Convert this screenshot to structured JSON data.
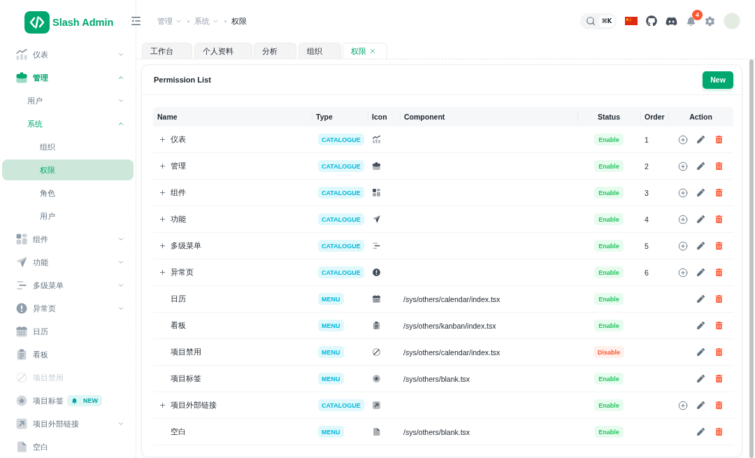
{
  "sidebar": {
    "title": "Slash Admin",
    "items": [
      {
        "label": "仪表",
        "expanded": false,
        "selected": false,
        "disabled": false
      },
      {
        "label": "管理",
        "expanded": true,
        "selected": false,
        "disabled": false,
        "children": [
          {
            "label": "用户",
            "expanded": false,
            "selected": false
          },
          {
            "label": "系统",
            "expanded": true,
            "selected": false,
            "children": [
              {
                "label": "组织",
                "selected": false
              },
              {
                "label": "权限",
                "selected": true
              },
              {
                "label": "角色",
                "selected": false
              },
              {
                "label": "用户",
                "selected": false
              }
            ]
          }
        ]
      },
      {
        "label": "组件",
        "expanded": false,
        "selected": false,
        "disabled": false
      },
      {
        "label": "功能",
        "expanded": false,
        "selected": false,
        "disabled": false
      },
      {
        "label": "多级菜单",
        "expanded": false,
        "selected": false,
        "disabled": false
      },
      {
        "label": "异常页",
        "expanded": false,
        "selected": false,
        "disabled": false
      },
      {
        "label": "日历",
        "selected": false,
        "disabled": false
      },
      {
        "label": "看板",
        "selected": false,
        "disabled": false
      },
      {
        "label": "项目禁用",
        "selected": false,
        "disabled": true
      },
      {
        "label": "项目标签",
        "selected": false,
        "disabled": false,
        "badge": "NEW"
      },
      {
        "label": "项目外部链接",
        "expanded": false,
        "selected": false,
        "disabled": false
      },
      {
        "label": "空白",
        "selected": false,
        "disabled": false
      }
    ]
  },
  "header": {
    "breadcrumb": [
      {
        "label": "管理",
        "dropdown": true
      },
      {
        "label": "系统",
        "dropdown": true
      },
      {
        "label": "权限",
        "dropdown": false
      }
    ],
    "search": {
      "shortcut": "⌘K"
    },
    "notifications": {
      "count": "4"
    }
  },
  "tabs": [
    {
      "label": "工作台",
      "selected": false
    },
    {
      "label": "个人资料",
      "selected": false
    },
    {
      "label": "分析",
      "selected": false
    },
    {
      "label": "组织",
      "selected": false
    },
    {
      "label": "权限",
      "selected": true
    }
  ],
  "card": {
    "title": "Permission List",
    "new_button": "New",
    "table": {
      "columns": [
        "Name",
        "Type",
        "Icon",
        "Component",
        "Status",
        "Order",
        "Action"
      ],
      "rows": [
        {
          "name": "仪表",
          "kind": "catalogue",
          "type": "CATALOGUE",
          "expanded": false,
          "status": {
            "label": "Enable",
            "enabled": true
          },
          "order": "1"
        },
        {
          "name": "管理",
          "kind": "catalogue",
          "type": "CATALOGUE",
          "expanded": false,
          "status": {
            "label": "Enable",
            "enabled": true
          },
          "order": "2"
        },
        {
          "name": "组件",
          "kind": "catalogue",
          "type": "CATALOGUE",
          "expanded": false,
          "status": {
            "label": "Enable",
            "enabled": true
          },
          "order": "3"
        },
        {
          "name": "功能",
          "kind": "catalogue",
          "type": "CATALOGUE",
          "expanded": false,
          "status": {
            "label": "Enable",
            "enabled": true
          },
          "order": "4"
        },
        {
          "name": "多级菜单",
          "kind": "catalogue",
          "type": "CATALOGUE",
          "expanded": false,
          "status": {
            "label": "Enable",
            "enabled": true
          },
          "order": "5"
        },
        {
          "name": "异常页",
          "kind": "catalogue",
          "type": "CATALOGUE",
          "expanded": false,
          "status": {
            "label": "Enable",
            "enabled": true
          },
          "order": "6"
        },
        {
          "name": "日历",
          "kind": "menu",
          "type": "MENU",
          "component": "/sys/others/calendar/index.tsx",
          "status": {
            "label": "Enable",
            "enabled": true
          }
        },
        {
          "name": "看板",
          "kind": "menu",
          "type": "MENU",
          "component": "/sys/others/kanban/index.tsx",
          "status": {
            "label": "Enable",
            "enabled": true
          }
        },
        {
          "name": "项目禁用",
          "kind": "menu",
          "type": "MENU",
          "component": "/sys/others/calendar/index.tsx",
          "status": {
            "label": "Disable",
            "enabled": false
          }
        },
        {
          "name": "项目标签",
          "kind": "menu",
          "type": "MENU",
          "component": "/sys/others/blank.tsx",
          "status": {
            "label": "Enable",
            "enabled": true
          }
        },
        {
          "name": "项目外部链接",
          "kind": "catalogue",
          "type": "CATALOGUE",
          "expanded": false,
          "status": {
            "label": "Enable",
            "enabled": true
          }
        },
        {
          "name": "空白",
          "kind": "menu",
          "type": "MENU",
          "component": "/sys/others/blank.tsx",
          "status": {
            "label": "Enable",
            "enabled": true
          }
        }
      ]
    }
  }
}
